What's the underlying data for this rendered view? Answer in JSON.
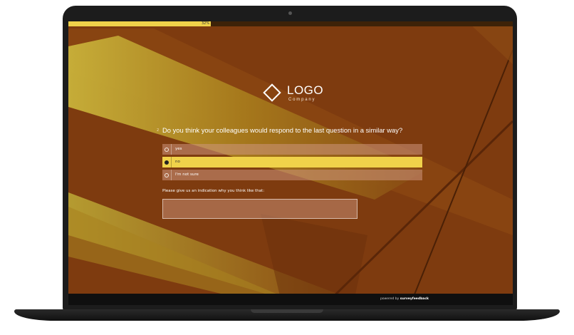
{
  "progress": {
    "value": 0.32,
    "label": "32%"
  },
  "logo": {
    "title": "LOGO",
    "subtitle": "Company"
  },
  "question": {
    "number": "2",
    "text": "Do you think your colleagues would respond to the last question in a similar way?",
    "options": [
      {
        "label": "yes",
        "selected": false
      },
      {
        "label": "no",
        "selected": true
      },
      {
        "label": "I'm not sure",
        "selected": false
      }
    ]
  },
  "reason": {
    "label": "Please give us an indication why you think like that:",
    "value": ""
  },
  "footer": {
    "powered_prefix": "powered by",
    "powered_brand": "surveyfeedback"
  },
  "colors": {
    "accent": "#f0d24a",
    "background": "#7a3a10"
  }
}
